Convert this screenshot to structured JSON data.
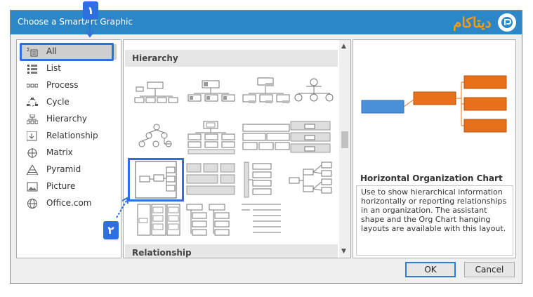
{
  "dialog": {
    "title": "Choose a SmartArt Graphic",
    "ok_label": "OK",
    "cancel_label": "Cancel"
  },
  "logo": {
    "text": "دیتاکام"
  },
  "categories": [
    {
      "label": "All",
      "icon": "all-icon",
      "selected": true
    },
    {
      "label": "List",
      "icon": "list-icon"
    },
    {
      "label": "Process",
      "icon": "process-icon"
    },
    {
      "label": "Cycle",
      "icon": "cycle-icon"
    },
    {
      "label": "Hierarchy",
      "icon": "hierarchy-icon"
    },
    {
      "label": "Relationship",
      "icon": "relationship-icon"
    },
    {
      "label": "Matrix",
      "icon": "matrix-icon"
    },
    {
      "label": "Pyramid",
      "icon": "pyramid-icon"
    },
    {
      "label": "Picture",
      "icon": "picture-icon"
    },
    {
      "label": "Office.com",
      "icon": "globe-icon"
    }
  ],
  "gallery": {
    "section_hierarchy": "Hierarchy",
    "section_relationship": "Relationship"
  },
  "preview": {
    "title": "Horizontal Organization Chart",
    "description": "Use to show hierarchical information horizontally or reporting relationships in an organization. The assistant shape and the Org Chart hanging layouts are available with this layout.",
    "box_glyph": "—"
  },
  "annotations": {
    "badge1": "١",
    "badge2": "٢"
  },
  "colors": {
    "titlebar": "#2b87c7",
    "selection": "#2d6fe0",
    "preview_blue": "#4a90d9",
    "preview_orange": "#e8701a"
  }
}
